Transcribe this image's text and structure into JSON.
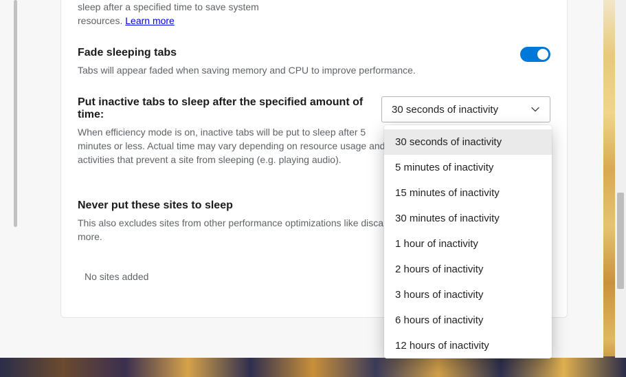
{
  "intro": {
    "fragment": "sleep after a specified time to save system resources.",
    "learn_more": "Learn more"
  },
  "fade": {
    "title": "Fade sleeping tabs",
    "sub": "Tabs will appear faded when saving memory and CPU to improve performance.",
    "enabled": true
  },
  "sleep_after": {
    "title": "Put inactive tabs to sleep after the specified amount of time:",
    "sub": "When efficiency mode is on, inactive tabs will be put to sleep after 5 minutes or less. Actual time may vary depending on resource usage and activities that prevent a site from sleeping (e.g. playing audio).",
    "selected": "30 seconds of inactivity",
    "options": [
      "30 seconds of inactivity",
      "5 minutes of inactivity",
      "15 minutes of inactivity",
      "30 minutes of inactivity",
      "1 hour of inactivity",
      "2 hours of inactivity",
      "3 hours of inactivity",
      "6 hours of inactivity",
      "12 hours of inactivity"
    ]
  },
  "never_sleep": {
    "title": "Never put these sites to sleep",
    "sub": "This also excludes sites from other performance optimizations like discarding mode, and more.",
    "empty": "No sites added"
  }
}
